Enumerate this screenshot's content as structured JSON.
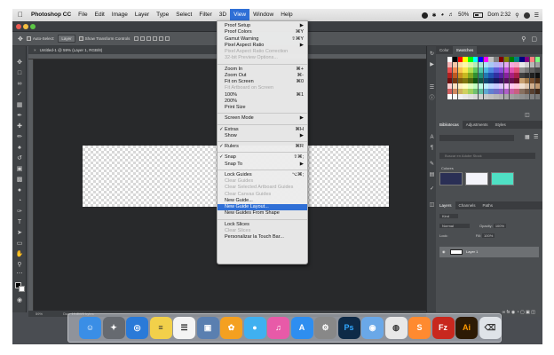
{
  "menubar": {
    "app_name": "Photoshop CC",
    "menus": [
      "File",
      "Edit",
      "Image",
      "Layer",
      "Type",
      "Select",
      "Filter",
      "3D",
      "View",
      "Window",
      "Help"
    ],
    "active_menu": "View",
    "status": {
      "battery": "50%",
      "battery_level": 0.5,
      "clock": "Dom 2:32"
    }
  },
  "options_bar": {
    "auto_select_label": "Auto-Select:",
    "auto_select_value": "Layer",
    "transform_label": "Show Transform Controls"
  },
  "document_tab": {
    "title": "Untitled-1 @ 59% (Layer 1, RGB/8)"
  },
  "view_menu": [
    {
      "label": "Proof Setup",
      "shortcut": "▶",
      "enabled": true
    },
    {
      "label": "Proof Colors",
      "shortcut": "⌘Y",
      "enabled": true
    },
    {
      "label": "Gamut Warning",
      "shortcut": "⇧⌘Y",
      "enabled": true
    },
    {
      "label": "Pixel Aspect Ratio",
      "shortcut": "▶",
      "enabled": true
    },
    {
      "label": "Pixel Aspect Ratio Correction",
      "shortcut": "",
      "enabled": false
    },
    {
      "label": "32-bit Preview Options...",
      "shortcut": "",
      "enabled": false
    },
    {
      "sep": true
    },
    {
      "label": "Zoom In",
      "shortcut": "⌘+",
      "enabled": true
    },
    {
      "label": "Zoom Out",
      "shortcut": "⌘-",
      "enabled": true
    },
    {
      "label": "Fit on Screen",
      "shortcut": "⌘0",
      "enabled": true
    },
    {
      "label": "Fit Artboard on Screen",
      "shortcut": "",
      "enabled": false
    },
    {
      "label": "100%",
      "shortcut": "⌘1",
      "enabled": true
    },
    {
      "label": "200%",
      "shortcut": "",
      "enabled": true
    },
    {
      "label": "Print Size",
      "shortcut": "",
      "enabled": true
    },
    {
      "sep": true
    },
    {
      "label": "Screen Mode",
      "shortcut": "▶",
      "enabled": true
    },
    {
      "sep": true
    },
    {
      "label": "Extras",
      "shortcut": "⌘H",
      "enabled": true,
      "checked": true
    },
    {
      "label": "Show",
      "shortcut": "▶",
      "enabled": true
    },
    {
      "sep": true
    },
    {
      "label": "Rulers",
      "shortcut": "⌘R",
      "enabled": true,
      "checked": true
    },
    {
      "sep": true
    },
    {
      "label": "Snap",
      "shortcut": "⇧⌘;",
      "enabled": true,
      "checked": true
    },
    {
      "label": "Snap To",
      "shortcut": "▶",
      "enabled": true
    },
    {
      "sep": true
    },
    {
      "label": "Lock Guides",
      "shortcut": "⌥⌘;",
      "enabled": true
    },
    {
      "label": "Clear Guides",
      "shortcut": "",
      "enabled": false
    },
    {
      "label": "Clear Selected Artboard Guides",
      "shortcut": "",
      "enabled": false
    },
    {
      "label": "Clear Canvas Guides",
      "shortcut": "",
      "enabled": false
    },
    {
      "label": "New Guide...",
      "shortcut": "",
      "enabled": true
    },
    {
      "label": "New Guide Layout...",
      "shortcut": "",
      "enabled": true,
      "highlighted": true
    },
    {
      "label": "New Guides From Shape",
      "shortcut": "",
      "enabled": true
    },
    {
      "sep": true
    },
    {
      "label": "Lock Slices",
      "shortcut": "",
      "enabled": true
    },
    {
      "label": "Clear Slices",
      "shortcut": "",
      "enabled": false
    },
    {
      "label": "Personalizar la Touch Bar...",
      "shortcut": "",
      "enabled": true
    }
  ],
  "panels": {
    "color_tabs": [
      "Color",
      "Swatches"
    ],
    "library_tabs": [
      "Bibliotecas",
      "Adjustments",
      "Styles"
    ],
    "library_search_placeholder": "Buscar en Adobe Stock",
    "library_section": "Colores",
    "layers_tabs": [
      "Layers",
      "Channels",
      "Paths"
    ],
    "kind_label": "Kind",
    "blend_mode": "Normal",
    "opacity_label": "Opacity:",
    "opacity_value": "100%",
    "lock_label": "Lock:",
    "fill_label": "Fill:",
    "fill_value": "100%",
    "layer_name": "Layer 1"
  },
  "status_bar": {
    "zoom": "59%",
    "doc_info": "Doc: 19.8M/0 bytes"
  },
  "dock_apps": [
    {
      "name": "finder-icon",
      "glyph": "☺",
      "color": "#3a8ee6"
    },
    {
      "name": "launchpad-icon",
      "glyph": "✦",
      "color": "#666a70"
    },
    {
      "name": "safari-icon",
      "glyph": "◎",
      "color": "#2a7ad8"
    },
    {
      "name": "notes-icon",
      "glyph": "≡",
      "color": "#f2d04a"
    },
    {
      "name": "reminders-icon",
      "glyph": "☰",
      "color": "#f4f4f4"
    },
    {
      "name": "preview-icon",
      "glyph": "▣",
      "color": "#5a7fb0"
    },
    {
      "name": "photos-icon",
      "glyph": "✿",
      "color": "#f4a020"
    },
    {
      "name": "messages-icon",
      "glyph": "●",
      "color": "#3fb0f0"
    },
    {
      "name": "itunes-icon",
      "glyph": "♫",
      "color": "#e85aa8"
    },
    {
      "name": "appstore-icon",
      "glyph": "A",
      "color": "#2e8ef0"
    },
    {
      "name": "system-preferences-icon",
      "glyph": "⚙",
      "color": "#888"
    },
    {
      "name": "photoshop-icon",
      "glyph": "Ps",
      "color": "#0e2a47"
    },
    {
      "name": "transmission-icon",
      "glyph": "◉",
      "color": "#6aa8e8"
    },
    {
      "name": "chrome-icon",
      "glyph": "◍",
      "color": "#e8e8e8"
    },
    {
      "name": "sublime-icon",
      "glyph": "S",
      "color": "#ff8a30"
    },
    {
      "name": "filezilla-icon",
      "glyph": "Fz",
      "color": "#c8281e"
    },
    {
      "name": "illustrator-icon",
      "glyph": "Ai",
      "color": "#2d1a04"
    },
    {
      "name": "trash-icon",
      "glyph": "⌫",
      "color": "#dfe3e8"
    }
  ],
  "colors": {
    "highlight": "#2f6fd6",
    "panel": "#4b4e51",
    "canvas_bg": "#28292b"
  }
}
